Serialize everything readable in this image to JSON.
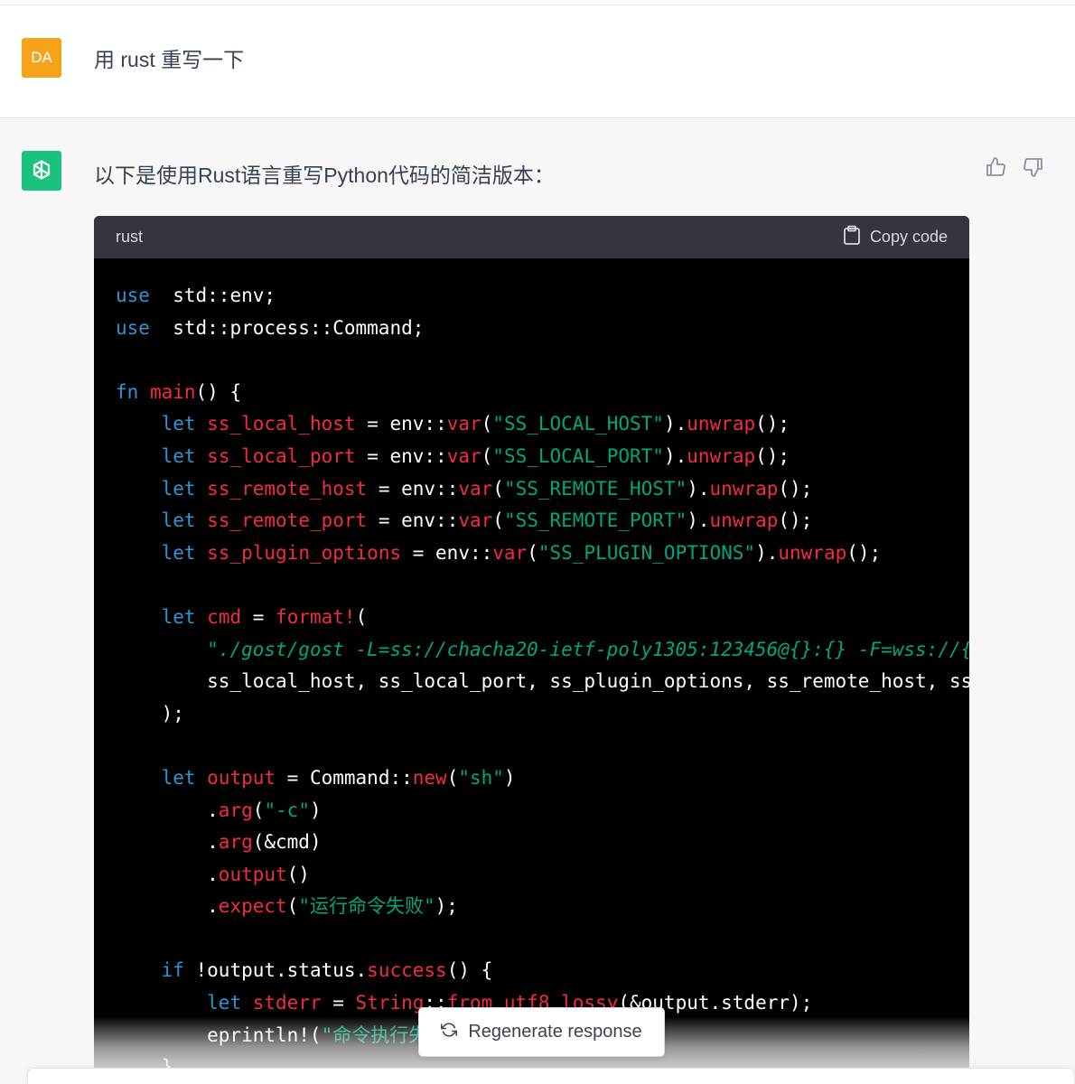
{
  "user_message": {
    "avatar_initials": "DA",
    "text": "用 rust 重写一下"
  },
  "assistant_message": {
    "intro": "以下是使用Rust语言重写Python代码的简洁版本：",
    "code_block": {
      "language": "rust",
      "copy_label": "Copy code",
      "lines": [
        [
          [
            "kw",
            "use"
          ],
          [
            "",
            "  std::env;"
          ]
        ],
        [
          [
            "kw",
            "use"
          ],
          [
            "",
            "  std::process::Command;"
          ]
        ],
        [],
        [
          [
            "kw",
            "fn"
          ],
          [
            "",
            " "
          ],
          [
            "fn",
            "main"
          ],
          [
            "",
            "() {"
          ]
        ],
        [
          [
            "",
            "    "
          ],
          [
            "kw",
            "let"
          ],
          [
            "",
            " "
          ],
          [
            "fn",
            "ss_local_host"
          ],
          [
            "",
            " = env::"
          ],
          [
            "fn",
            "var"
          ],
          [
            "",
            "("
          ],
          [
            "st",
            "\"SS_LOCAL_HOST\""
          ],
          [
            "",
            ")."
          ],
          [
            "fn",
            "unwrap"
          ],
          [
            "",
            "();"
          ]
        ],
        [
          [
            "",
            "    "
          ],
          [
            "kw",
            "let"
          ],
          [
            "",
            " "
          ],
          [
            "fn",
            "ss_local_port"
          ],
          [
            "",
            " = env::"
          ],
          [
            "fn",
            "var"
          ],
          [
            "",
            "("
          ],
          [
            "st",
            "\"SS_LOCAL_PORT\""
          ],
          [
            "",
            ")."
          ],
          [
            "fn",
            "unwrap"
          ],
          [
            "",
            "();"
          ]
        ],
        [
          [
            "",
            "    "
          ],
          [
            "kw",
            "let"
          ],
          [
            "",
            " "
          ],
          [
            "fn",
            "ss_remote_host"
          ],
          [
            "",
            " = env::"
          ],
          [
            "fn",
            "var"
          ],
          [
            "",
            "("
          ],
          [
            "st",
            "\"SS_REMOTE_HOST\""
          ],
          [
            "",
            ")."
          ],
          [
            "fn",
            "unwrap"
          ],
          [
            "",
            "();"
          ]
        ],
        [
          [
            "",
            "    "
          ],
          [
            "kw",
            "let"
          ],
          [
            "",
            " "
          ],
          [
            "fn",
            "ss_remote_port"
          ],
          [
            "",
            " = env::"
          ],
          [
            "fn",
            "var"
          ],
          [
            "",
            "("
          ],
          [
            "st",
            "\"SS_REMOTE_PORT\""
          ],
          [
            "",
            ")."
          ],
          [
            "fn",
            "unwrap"
          ],
          [
            "",
            "();"
          ]
        ],
        [
          [
            "",
            "    "
          ],
          [
            "kw",
            "let"
          ],
          [
            "",
            " "
          ],
          [
            "fn",
            "ss_plugin_options"
          ],
          [
            "",
            " = env::"
          ],
          [
            "fn",
            "var"
          ],
          [
            "",
            "("
          ],
          [
            "st",
            "\"SS_PLUGIN_OPTIONS\""
          ],
          [
            "",
            ")."
          ],
          [
            "fn",
            "unwrap"
          ],
          [
            "",
            "();"
          ]
        ],
        [],
        [
          [
            "",
            "    "
          ],
          [
            "kw",
            "let"
          ],
          [
            "",
            " "
          ],
          [
            "fn",
            "cmd"
          ],
          [
            "",
            " = "
          ],
          [
            "fn",
            "format!"
          ],
          [
            "",
            "("
          ]
        ],
        [
          [
            "",
            "        "
          ],
          [
            "st it",
            "\"./gost/gost -L=ss://chacha20-ietf-poly1305:123456@{}:{} -F=wss://{}"
          ]
        ],
        [
          [
            "",
            "        ss_local_host, ss_local_port, ss_plugin_options, ss_remote_host, ss_"
          ]
        ],
        [
          [
            "",
            "    );"
          ]
        ],
        [],
        [
          [
            "",
            "    "
          ],
          [
            "kw",
            "let"
          ],
          [
            "",
            " "
          ],
          [
            "fn",
            "output"
          ],
          [
            "",
            " = Command::"
          ],
          [
            "fn",
            "new"
          ],
          [
            "",
            "("
          ],
          [
            "st",
            "\"sh\""
          ],
          [
            "",
            ")"
          ]
        ],
        [
          [
            "",
            "        ."
          ],
          [
            "fn",
            "arg"
          ],
          [
            "",
            "("
          ],
          [
            "st",
            "\"-c\""
          ],
          [
            "",
            ")"
          ]
        ],
        [
          [
            "",
            "        ."
          ],
          [
            "fn",
            "arg"
          ],
          [
            "",
            "(&cmd)"
          ]
        ],
        [
          [
            "",
            "        ."
          ],
          [
            "fn",
            "output"
          ],
          [
            "",
            "()"
          ]
        ],
        [
          [
            "",
            "        ."
          ],
          [
            "fn",
            "expect"
          ],
          [
            "",
            "("
          ],
          [
            "st",
            "\"运行命令失败\""
          ],
          [
            "",
            ");"
          ]
        ],
        [],
        [
          [
            "",
            "    "
          ],
          [
            "kw",
            "if"
          ],
          [
            "",
            " !output.status."
          ],
          [
            "fn",
            "success"
          ],
          [
            "",
            "() {"
          ]
        ],
        [
          [
            "",
            "        "
          ],
          [
            "kw",
            "let"
          ],
          [
            "",
            " "
          ],
          [
            "fn",
            "stderr"
          ],
          [
            "",
            " = "
          ],
          [
            "fn",
            "String"
          ],
          [
            "",
            "::"
          ],
          [
            "fn",
            "from_utf8_lossy"
          ],
          [
            "",
            "(&output.stderr);"
          ]
        ],
        [
          [
            "",
            "        eprintln!("
          ],
          [
            "st",
            "\"命令执行失"
          ]
        ],
        [
          [
            "",
            "    }"
          ]
        ]
      ]
    }
  },
  "regenerate_label": "Regenerate response",
  "colors": {
    "user_avatar": "#f5a31a",
    "bot_avatar": "#19c37d",
    "keyword": "#2e95d3",
    "function": "#f22c3d",
    "string": "#00a67d"
  }
}
